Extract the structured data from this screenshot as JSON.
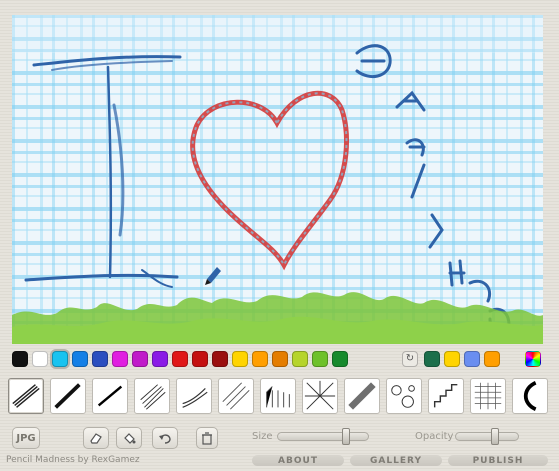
{
  "palette": {
    "colors": [
      "#111111",
      "#ffffff",
      "#19c3f0",
      "#1580e6",
      "#2c4fbf",
      "#e01fe0",
      "#c01ac9",
      "#8a1ae6",
      "#e01818",
      "#c41010",
      "#9a0f0f",
      "#ffd400",
      "#ff9f00",
      "#e47d00",
      "#b6d42b",
      "#6ec12a",
      "#178a2d"
    ],
    "selected_index": 2,
    "extra_colors": [
      "#1c6f4b",
      "#ffd400",
      "#6a8ef0",
      "#ff9f00"
    ],
    "swap_icon": "cycle-arrows-icon",
    "color_picker_icon": "color-wheel-icon"
  },
  "brushes": {
    "count": 15,
    "selected_index": 0
  },
  "toolbar": {
    "jpg_label": "JPG",
    "eraser_icon": "eraser-icon",
    "fill_icon": "paint-bucket-icon",
    "undo_icon": "undo-icon",
    "trash_icon": "trash-icon"
  },
  "sliders": {
    "size_label": "Size",
    "opacity_label": "Opacity",
    "size_value": 0.76,
    "opacity_value": 0.62
  },
  "footer": {
    "credit": "Pencil Madness by RexGamez",
    "about": "ABOUT",
    "gallery": "GALLERY",
    "publish": "PUBLISH"
  },
  "drawing": {
    "grass_color": "#7cc63a",
    "heart_color": "#d53a3a",
    "stroke_color": "#2f63a8",
    "grid_color": "#5fc6ee"
  }
}
